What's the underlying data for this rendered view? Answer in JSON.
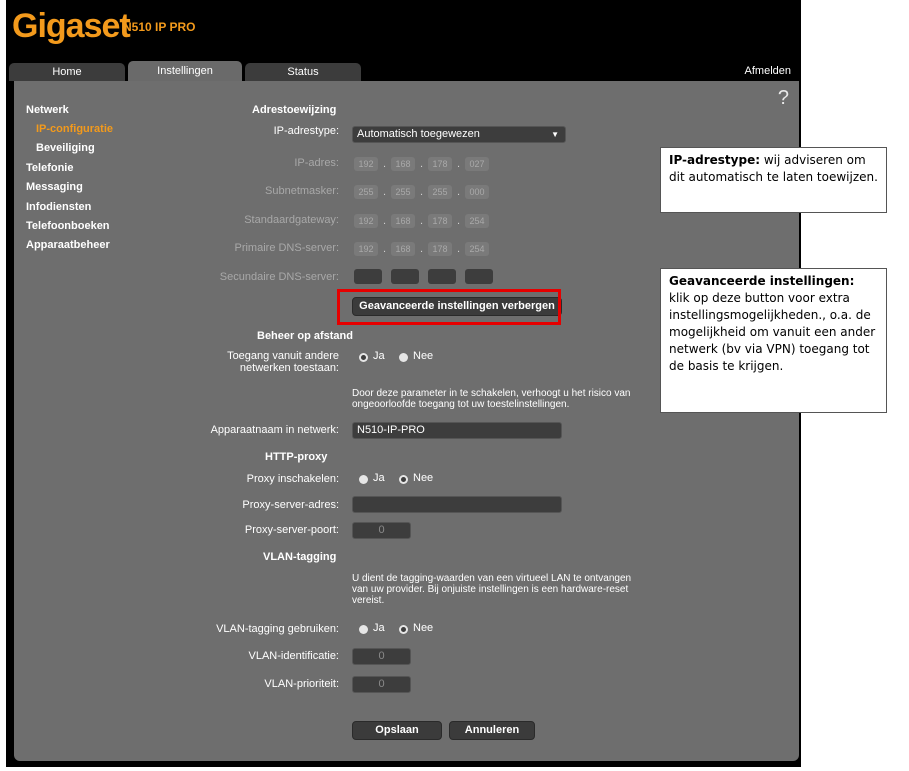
{
  "brand": {
    "logo": "Gigaset",
    "model": "N510 IP PRO"
  },
  "tabs": [
    "Home",
    "Instellingen",
    "Status"
  ],
  "logout": "Afmelden",
  "help": "?",
  "sidebar": [
    {
      "label": "Netwerk"
    },
    {
      "label": "IP-configuratie"
    },
    {
      "label": "Beveiliging"
    },
    {
      "label": "Telefonie"
    },
    {
      "label": "Messaging"
    },
    {
      "label": "Infodiensten"
    },
    {
      "label": "Telefoonboeken"
    },
    {
      "label": "Apparaatbeheer"
    }
  ],
  "addr": {
    "title": "Adrestoewijzing",
    "type_label": "IP-adrestype:",
    "type_value": "Automatisch toegewezen",
    "ip_label": "IP-adres:",
    "ip": [
      "192",
      "168",
      "178",
      "027"
    ],
    "mask_label": "Subnetmasker:",
    "mask": [
      "255",
      "255",
      "255",
      "000"
    ],
    "gw_label": "Standaardgateway:",
    "gw": [
      "192",
      "168",
      "178",
      "254"
    ],
    "dns1_label": "Primaire DNS-server:",
    "dns1": [
      "192",
      "168",
      "178",
      "254"
    ],
    "dns2_label": "Secundaire DNS-server:",
    "advanced_button": "Geavanceerde instellingen verbergen"
  },
  "remote": {
    "title": "Beheer op afstand",
    "access_label_1": "Toegang vanuit andere",
    "access_label_2": "netwerken toestaan:",
    "yes": "Ja",
    "no": "Nee",
    "warning_1": "Door deze parameter in te schakelen, verhoogt u het risico van",
    "warning_2": "ongeoorloofde toegang tot uw toestelinstellingen.",
    "devname_label": "Apparaatnaam in netwerk:",
    "devname_value": "N510-IP-PRO"
  },
  "proxy": {
    "title": "HTTP-proxy",
    "enable_label": "Proxy inschakelen:",
    "yes": "Ja",
    "no": "Nee",
    "addr_label": "Proxy-server-adres:",
    "port_label": "Proxy-server-poort:",
    "port_value": "0"
  },
  "vlan": {
    "title": "VLAN-tagging",
    "note_1": "U dient de tagging-waarden van een virtueel LAN te ontvangen",
    "note_2": "van uw provider. Bij onjuiste instellingen is een hardware-reset",
    "note_3": "vereist.",
    "use_label": "VLAN-tagging gebruiken:",
    "yes": "Ja",
    "no": "Nee",
    "id_label": "VLAN-identificatie:",
    "id_value": "0",
    "prio_label": "VLAN-prioriteit:",
    "prio_value": "0"
  },
  "buttons": {
    "save": "Opslaan",
    "cancel": "Annuleren"
  },
  "callouts": {
    "c1_title": "IP-adrestype:",
    "c1_text": "wij adviseren om dit automatisch te laten toewijzen.",
    "c2_title": "Geavanceerde instellingen:",
    "c2_text": "klik op deze button voor extra instellingsmogelijkheden., o.a. de mogelijkheid om vanuit een ander netwerk (bv via VPN) toegang tot de basis te krijgen."
  },
  "colors": {
    "accent": "#f39a1c",
    "panel": "#6e6e6e",
    "highlight": "#e60000"
  }
}
